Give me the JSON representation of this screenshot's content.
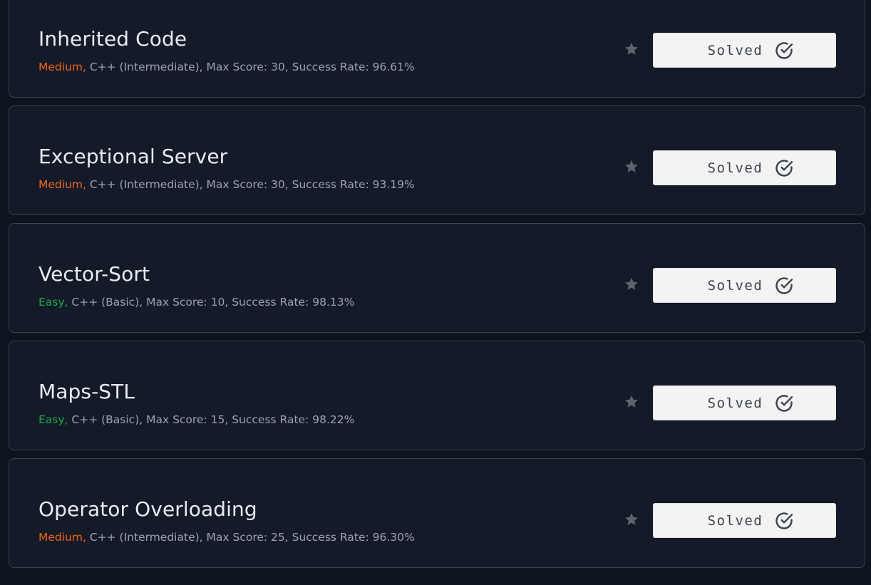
{
  "colors": {
    "page_bg": "#0e141e",
    "card_bg": "#141a28",
    "card_border": "#3b4250",
    "medium": "#f06416",
    "easy": "#1ba94c",
    "meta_text": "#9aa3b2",
    "star": "#5c6470",
    "button_bg": "#f3f3f3",
    "button_text": "#39424e"
  },
  "challenges": [
    {
      "title": "Inherited Code",
      "difficulty": "Medium,",
      "details": " C++ (Intermediate), Max Score: 30, Success Rate: 96.61%",
      "status": "Solved",
      "star_icon": "star-icon",
      "status_icon": "check-circle-icon"
    },
    {
      "title": "Exceptional Server",
      "difficulty": "Medium,",
      "details": " C++ (Intermediate), Max Score: 30, Success Rate: 93.19%",
      "status": "Solved",
      "star_icon": "star-icon",
      "status_icon": "check-circle-icon"
    },
    {
      "title": "Vector-Sort",
      "difficulty": "Easy,",
      "details": " C++ (Basic), Max Score: 10, Success Rate: 98.13%",
      "status": "Solved",
      "star_icon": "star-icon",
      "status_icon": "check-circle-icon"
    },
    {
      "title": "Maps-STL",
      "difficulty": "Easy,",
      "details": " C++ (Basic), Max Score: 15, Success Rate: 98.22%",
      "status": "Solved",
      "star_icon": "star-icon",
      "status_icon": "check-circle-icon"
    },
    {
      "title": "Operator Overloading",
      "difficulty": "Medium,",
      "details": " C++ (Intermediate), Max Score: 25, Success Rate: 96.30%",
      "status": "Solved",
      "star_icon": "star-icon",
      "status_icon": "check-circle-icon"
    }
  ]
}
